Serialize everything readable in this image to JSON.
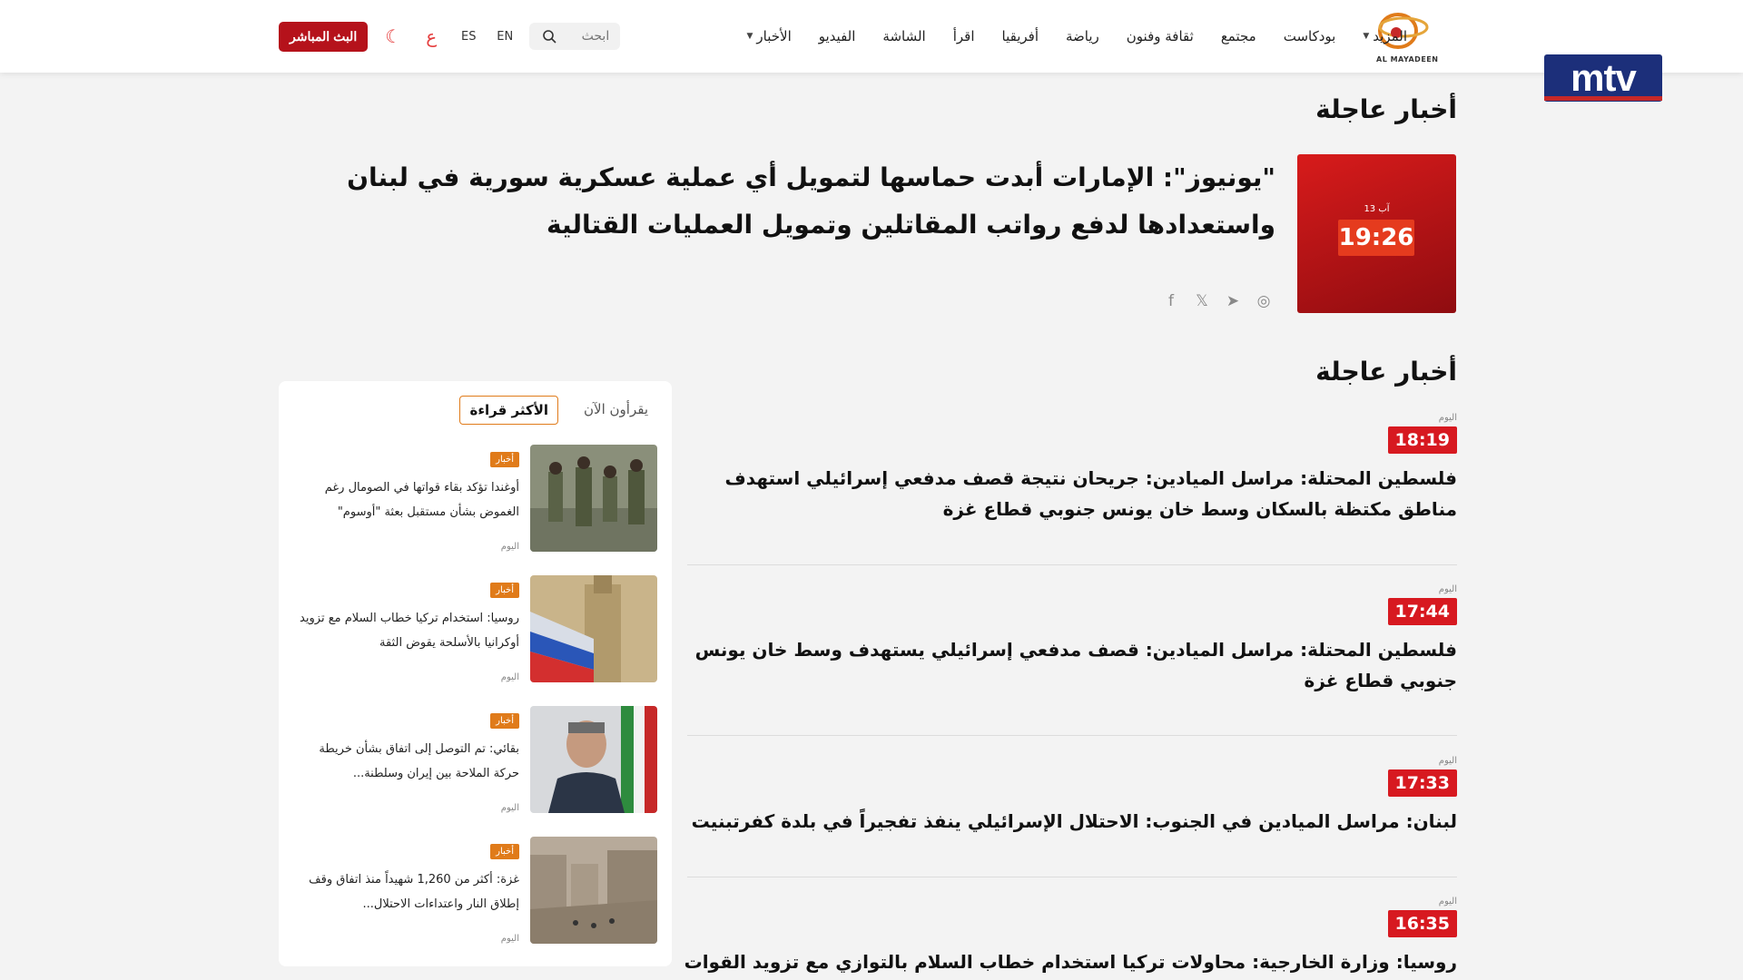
{
  "header": {
    "logo_text": "AL MAYADEEN",
    "nav": [
      {
        "label": "الأخبار",
        "has_caret": true
      },
      {
        "label": "الفيديو",
        "has_caret": false
      },
      {
        "label": "الشاشة",
        "has_caret": false
      },
      {
        "label": "اقرأ",
        "has_caret": false
      },
      {
        "label": "أفريقيا",
        "has_caret": false
      },
      {
        "label": "رياضة",
        "has_caret": false
      },
      {
        "label": "ثقافة وفنون",
        "has_caret": false
      },
      {
        "label": "مجتمع",
        "has_caret": false
      },
      {
        "label": "بودكاست",
        "has_caret": false
      },
      {
        "label": "المزيد",
        "has_caret": true
      }
    ],
    "search_placeholder": "ابحث",
    "lang_en": "EN",
    "lang_es": "ES",
    "arabic_glyph": "ع",
    "live_button": "البث المباشر"
  },
  "overlay_logo": "mtv",
  "hero": {
    "section_title": "أخبار عاجلة",
    "image_date": "13 آب",
    "image_time": "19:26",
    "title": "\"يونيوز\": الإمارات أبدت حماسها لتمويل أي عملية عسكرية سورية في لبنان واستعدادها لدفع رواتب المقاتلين وتمويل العمليات القتالية"
  },
  "breaking": {
    "section_title": "أخبار عاجلة",
    "items": [
      {
        "day": "اليوم",
        "time": "18:19",
        "title": "فلسطين المحتلة: مراسل الميادين: جريحان نتيجة قصف مدفعي إسرائيلي استهدف مناطق مكتظة بالسكان وسط خان يونس جنوبي قطاع غزة"
      },
      {
        "day": "اليوم",
        "time": "17:44",
        "title": "فلسطين المحتلة: مراسل الميادين: قصف مدفعي إسرائيلي يستهدف وسط خان يونس جنوبي قطاع غزة"
      },
      {
        "day": "اليوم",
        "time": "17:33",
        "title": "لبنان: مراسل الميادين في الجنوب: الاحتلال الإسرائيلي ينفذ تفجيراً في بلدة كفرتبنيت"
      },
      {
        "day": "اليوم",
        "time": "16:35",
        "title": "روسيا: وزارة الخارجية: محاولات تركيا استخدام خطاب السلام بالتوازي مع تزويد القوات المسلحة"
      }
    ]
  },
  "sidebar": {
    "tab_most_read": "الأكثر قراءة",
    "tab_reading_now": "يقرأون الآن",
    "cards": [
      {
        "tag": "أخبار",
        "title": "أوغندا تؤكد بقاء قواتها في الصومال رغم الغموض بشأن مستقبل بعثة \"أوسوم\"",
        "day": "اليوم"
      },
      {
        "tag": "أخبار",
        "title": "روسيا: استخدام تركيا خطاب السلام مع تزويد أوكرانيا بالأسلحة يقوض الثقة",
        "day": "اليوم"
      },
      {
        "tag": "أخبار",
        "title": "بقائي: تم التوصل إلى اتفاق بشأن خريطة حركة الملاحة بين إيران وسلطنة...",
        "day": "اليوم"
      },
      {
        "tag": "أخبار",
        "title": "غزة: أكثر من 1,260 شهيداً منذ اتفاق وقف إطلاق النار واعتداءات الاحتلال...",
        "day": "اليوم"
      }
    ]
  }
}
